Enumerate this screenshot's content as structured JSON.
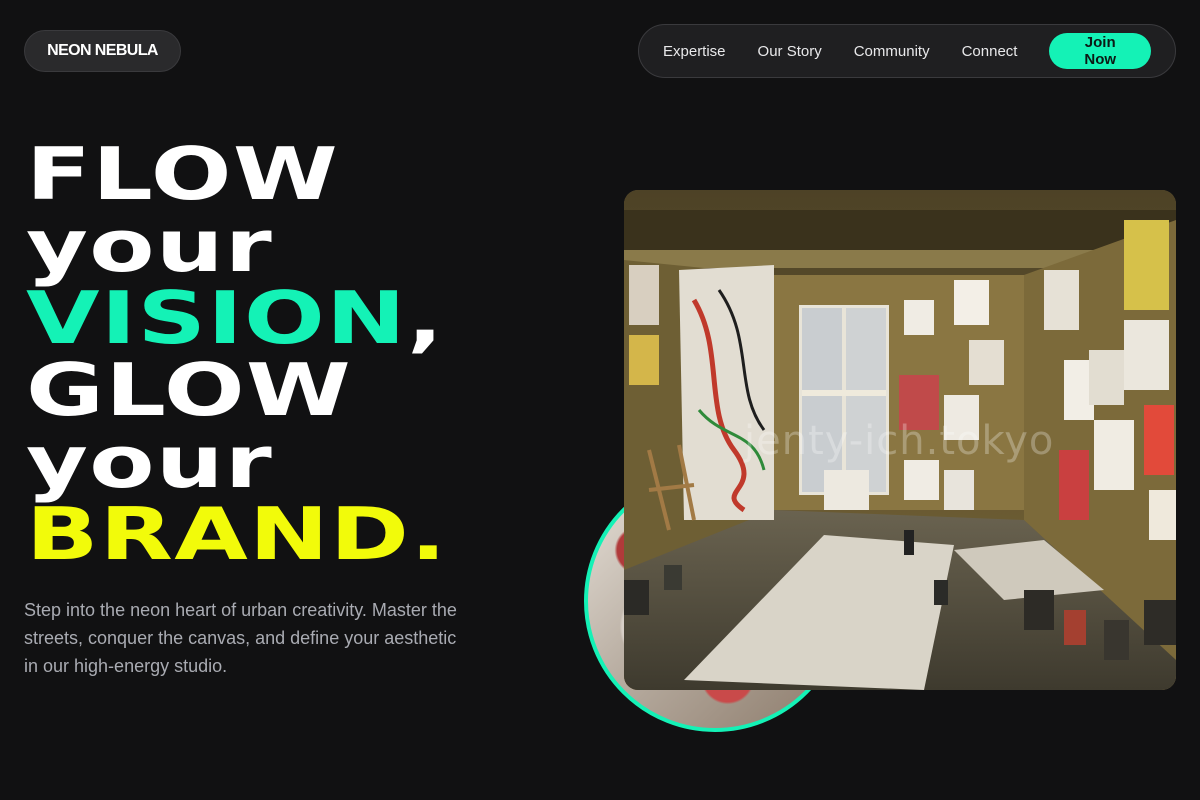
{
  "header": {
    "brand": "NEON NEBULA",
    "nav": [
      {
        "label": "Expertise"
      },
      {
        "label": "Our Story"
      },
      {
        "label": "Community"
      },
      {
        "label": "Connect"
      }
    ],
    "cta": "Join Now"
  },
  "hero": {
    "lines": [
      "FLOW",
      "your",
      "VISION",
      "GLOW",
      "your",
      "BRAND."
    ],
    "comma": ",",
    "description": "Step into the neon heart of urban creativity. Master the streets, conquer the canvas, and define your aesthetic in our high-energy studio."
  },
  "media": {
    "photo_icon": "art-studio-photo",
    "circle_icon": "paint-palette-photo",
    "watermark": "jenty-ich.tokyo"
  },
  "colors": {
    "background": "#111112",
    "accent_green": "#14f2b6",
    "accent_yellow": "#f2fb0a",
    "muted_text": "#a9abb2"
  }
}
